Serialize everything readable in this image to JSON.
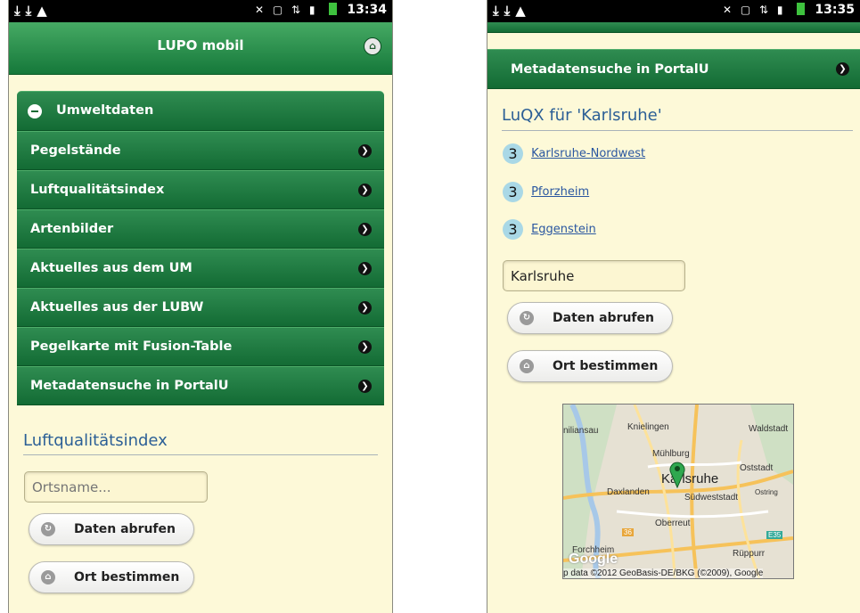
{
  "left": {
    "status": {
      "left_icons": "⤓⤓▲",
      "right_icons": "✕ ▢ ⇅ ▮",
      "time": "13:34"
    },
    "header": {
      "title": "LUPO mobil",
      "home_icon": "home-icon"
    },
    "menu": {
      "header_label": "Umweltdaten",
      "items": [
        {
          "label": "Pegelstände"
        },
        {
          "label": "Luftqualitätsindex"
        },
        {
          "label": "Artenbilder"
        },
        {
          "label": "Aktuelles aus dem UM"
        },
        {
          "label": "Aktuelles aus der LUBW"
        },
        {
          "label": "Pegelkarte mit Fusion-Table"
        },
        {
          "label": "Metadatensuche in PortalU"
        }
      ]
    },
    "section": {
      "title": "Luftqualitätsindex"
    },
    "input": {
      "placeholder": "Ortsname..."
    },
    "buttons": {
      "fetch": "Daten abrufen",
      "locate": "Ort bestimmen"
    }
  },
  "right": {
    "status": {
      "left_icons": "⤓⤓▲",
      "right_icons": "✕ ▢ ⇅ ▮",
      "time": "13:35"
    },
    "menu_item": "Metadatensuche in PortalU",
    "section": {
      "title": "LuQX für 'Karlsruhe'"
    },
    "results": [
      {
        "index": "3",
        "name": "Karlsruhe-Nordwest"
      },
      {
        "index": "3",
        "name": "Pforzheim"
      },
      {
        "index": "3",
        "name": "Eggenstein"
      }
    ],
    "input": {
      "value": "Karlsruhe"
    },
    "buttons": {
      "fetch": "Daten abrufen",
      "locate": "Ort bestimmen"
    },
    "map": {
      "city": "Karlsruhe",
      "labels": {
        "knielingen": "Knielingen",
        "waldstadt": "Waldstadt",
        "muehlburg": "Mühlburg",
        "oststadt": "Oststadt",
        "daxlanden": "Daxlanden",
        "suedweststadt": "Südweststadt",
        "oberreut": "Oberreut",
        "forchheim": "Forchheim",
        "rueppurr": "Rüppurr",
        "miliansau": "niliansau",
        "ostring": "Ostring"
      },
      "road_e35": "E35",
      "road_36": "36",
      "logo": "Google",
      "copyright": "p data ©2012 GeoBasis-DE/BKG (©2009), Google"
    }
  }
}
